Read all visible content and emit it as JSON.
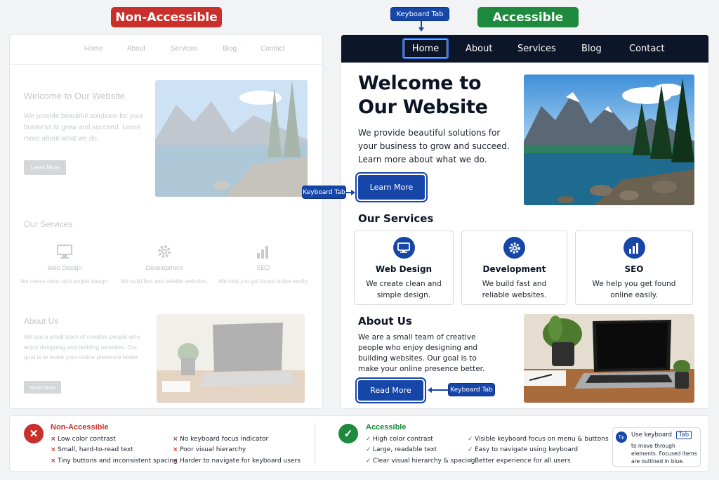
{
  "labels": {
    "non_accessible": "Non-Accessible",
    "accessible": "Accessible"
  },
  "keyboard_tip": "Keyboard Tab",
  "nav": [
    "Home",
    "About",
    "Services",
    "Blog",
    "Contact"
  ],
  "hero": {
    "title_line1": "Welcome to",
    "title_line2": "Our Website",
    "title_full": "Welcome to Our Website",
    "text": "We provide beautiful solutions for your business to grow and succeed. Learn more about what we do.",
    "button": "Learn More"
  },
  "services": {
    "heading": "Our Services",
    "items": [
      {
        "title": "Web Design",
        "text": "We create clean and simple design.",
        "icon": "monitor-icon"
      },
      {
        "title": "Development",
        "text": "We build fast and reliable websites.",
        "icon": "gear-icon"
      },
      {
        "title": "SEO",
        "text": "We help you get found online easily.",
        "icon": "bar-chart-icon"
      }
    ]
  },
  "about": {
    "heading": "About Us",
    "text": "We are a small team of creative people who enjoy designing and building websites. Our goal is to make your online presence better.",
    "button": "Read More"
  },
  "legend": {
    "bad_title": "Non-Accessible",
    "bad_items": [
      "Low color contrast",
      "Small, hard-to-read text",
      "Tiny buttons and inconsistent spacing",
      "No keyboard focus indicator",
      "Poor visual hierarchy",
      "Harder to navigate for keyboard users"
    ],
    "good_title": "Accessible",
    "good_items": [
      "High color contrast",
      "Large, readable text",
      "Clear visual hierarchy & spacing",
      "Visible keyboard focus on menu & buttons",
      "Easy to navigate using keyboard",
      "Better experience for all users"
    ],
    "tip_badge": "Tip",
    "tip_prefix": "Use keyboard",
    "tip_key": "Tab",
    "tip_rest": "to move through elements. Focused items are outlined in blue."
  },
  "colors": {
    "bad": "#c9302c",
    "good": "#1e8a3e",
    "focus": "#1646a8",
    "nav_bg": "#0d1529"
  }
}
